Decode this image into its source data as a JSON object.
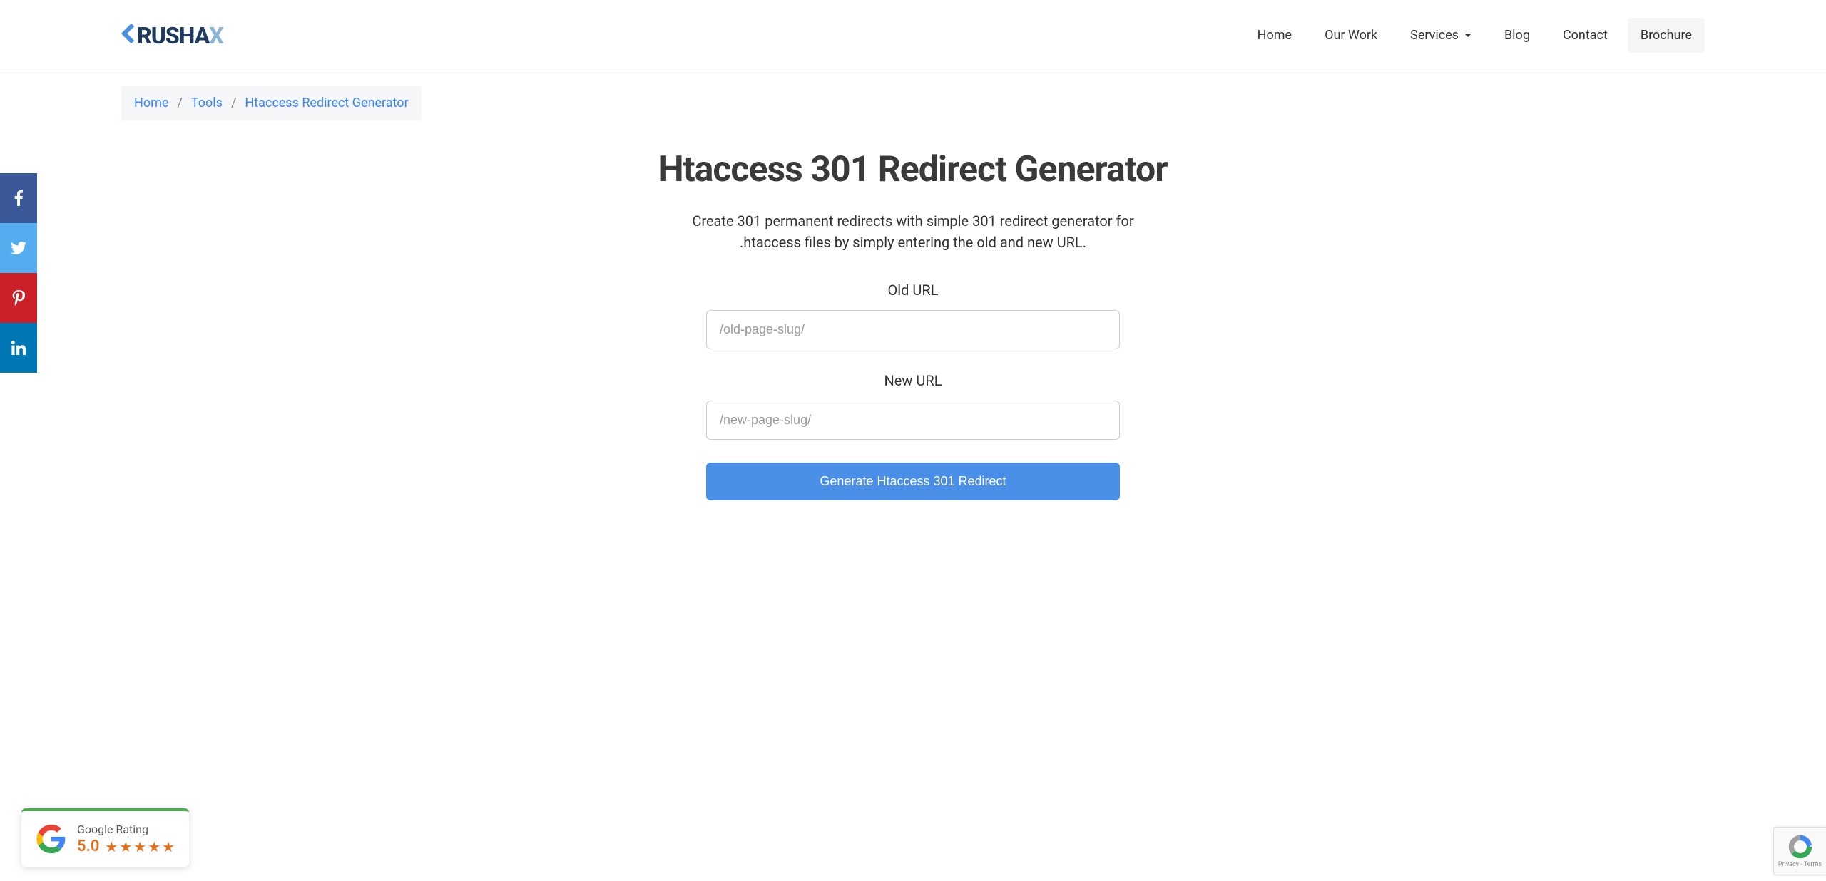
{
  "logo": {
    "text_main": "RUSHA",
    "text_x": "X"
  },
  "nav": {
    "home": "Home",
    "our_work": "Our Work",
    "services": "Services",
    "blog": "Blog",
    "contact": "Contact",
    "brochure": "Brochure"
  },
  "breadcrumb": {
    "home": "Home",
    "tools": "Tools",
    "current": "Htaccess Redirect Generator",
    "separator": "/"
  },
  "page": {
    "title": "Htaccess 301 Redirect Generator",
    "description": "Create 301 permanent redirects with simple 301 redirect generator for .htaccess files by simply entering the old and new URL."
  },
  "form": {
    "old_url_label": "Old URL",
    "old_url_placeholder": "/old-page-slug/",
    "new_url_label": "New URL",
    "new_url_placeholder": "/new-page-slug/",
    "generate_button": "Generate Htaccess 301 Redirect"
  },
  "google_rating": {
    "title": "Google Rating",
    "score": "5.0"
  },
  "recaptcha": {
    "privacy": "Privacy",
    "terms": "Terms",
    "separator": " - "
  }
}
